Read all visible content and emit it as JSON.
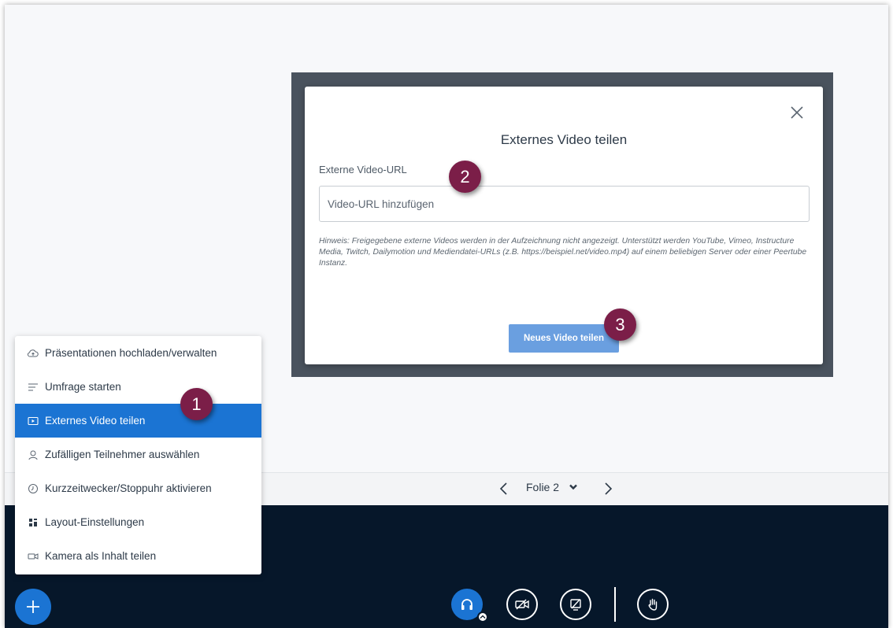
{
  "modal": {
    "title": "Externes Video teilen",
    "url_label": "Externe Video-URL",
    "url_placeholder": "Video-URL hinzufügen",
    "url_value": "",
    "hint": "Hinweis: Freigegebene externe Videos werden in der Aufzeichnung nicht angezeigt. Unterstützt werden YouTube, Vimeo, Instructure Media, Twitch, Dailymotion und Mediendatei-URLs (z.B. https://beispiel.net/video.mp4) auf einem beliebigen Server oder einer Peertube Instanz.",
    "share_button": "Neues Video teilen",
    "close_icon": "close-icon"
  },
  "slide_nav": {
    "current": "Folie 2",
    "prev_icon": "chevron-left-icon",
    "next_icon": "chevron-right-icon",
    "dropdown_icon": "chevron-down-icon"
  },
  "menu": {
    "items": [
      {
        "label": "Präsentationen hochladen/verwalten",
        "icon": "cloud-upload-icon",
        "active": false
      },
      {
        "label": "Umfrage starten",
        "icon": "poll-icon",
        "active": false
      },
      {
        "label": "Externes Video teilen",
        "icon": "external-video-icon",
        "active": true
      },
      {
        "label": "Zufälligen Teilnehmer auswählen",
        "icon": "user-icon",
        "active": false
      },
      {
        "label": "Kurzzeitwecker/Stoppuhr aktivieren",
        "icon": "timer-icon",
        "active": false
      },
      {
        "label": "Layout-Einstellungen",
        "icon": "layout-icon",
        "active": false
      },
      {
        "label": "Kamera als Inhalt teilen",
        "icon": "camera-icon",
        "active": false
      }
    ]
  },
  "badges": [
    "1",
    "2",
    "3"
  ],
  "colors": {
    "accent": "#1b74d3",
    "badge": "#7b1e48",
    "actionbar": "#06172a",
    "share_button": "#6a9fe0"
  }
}
